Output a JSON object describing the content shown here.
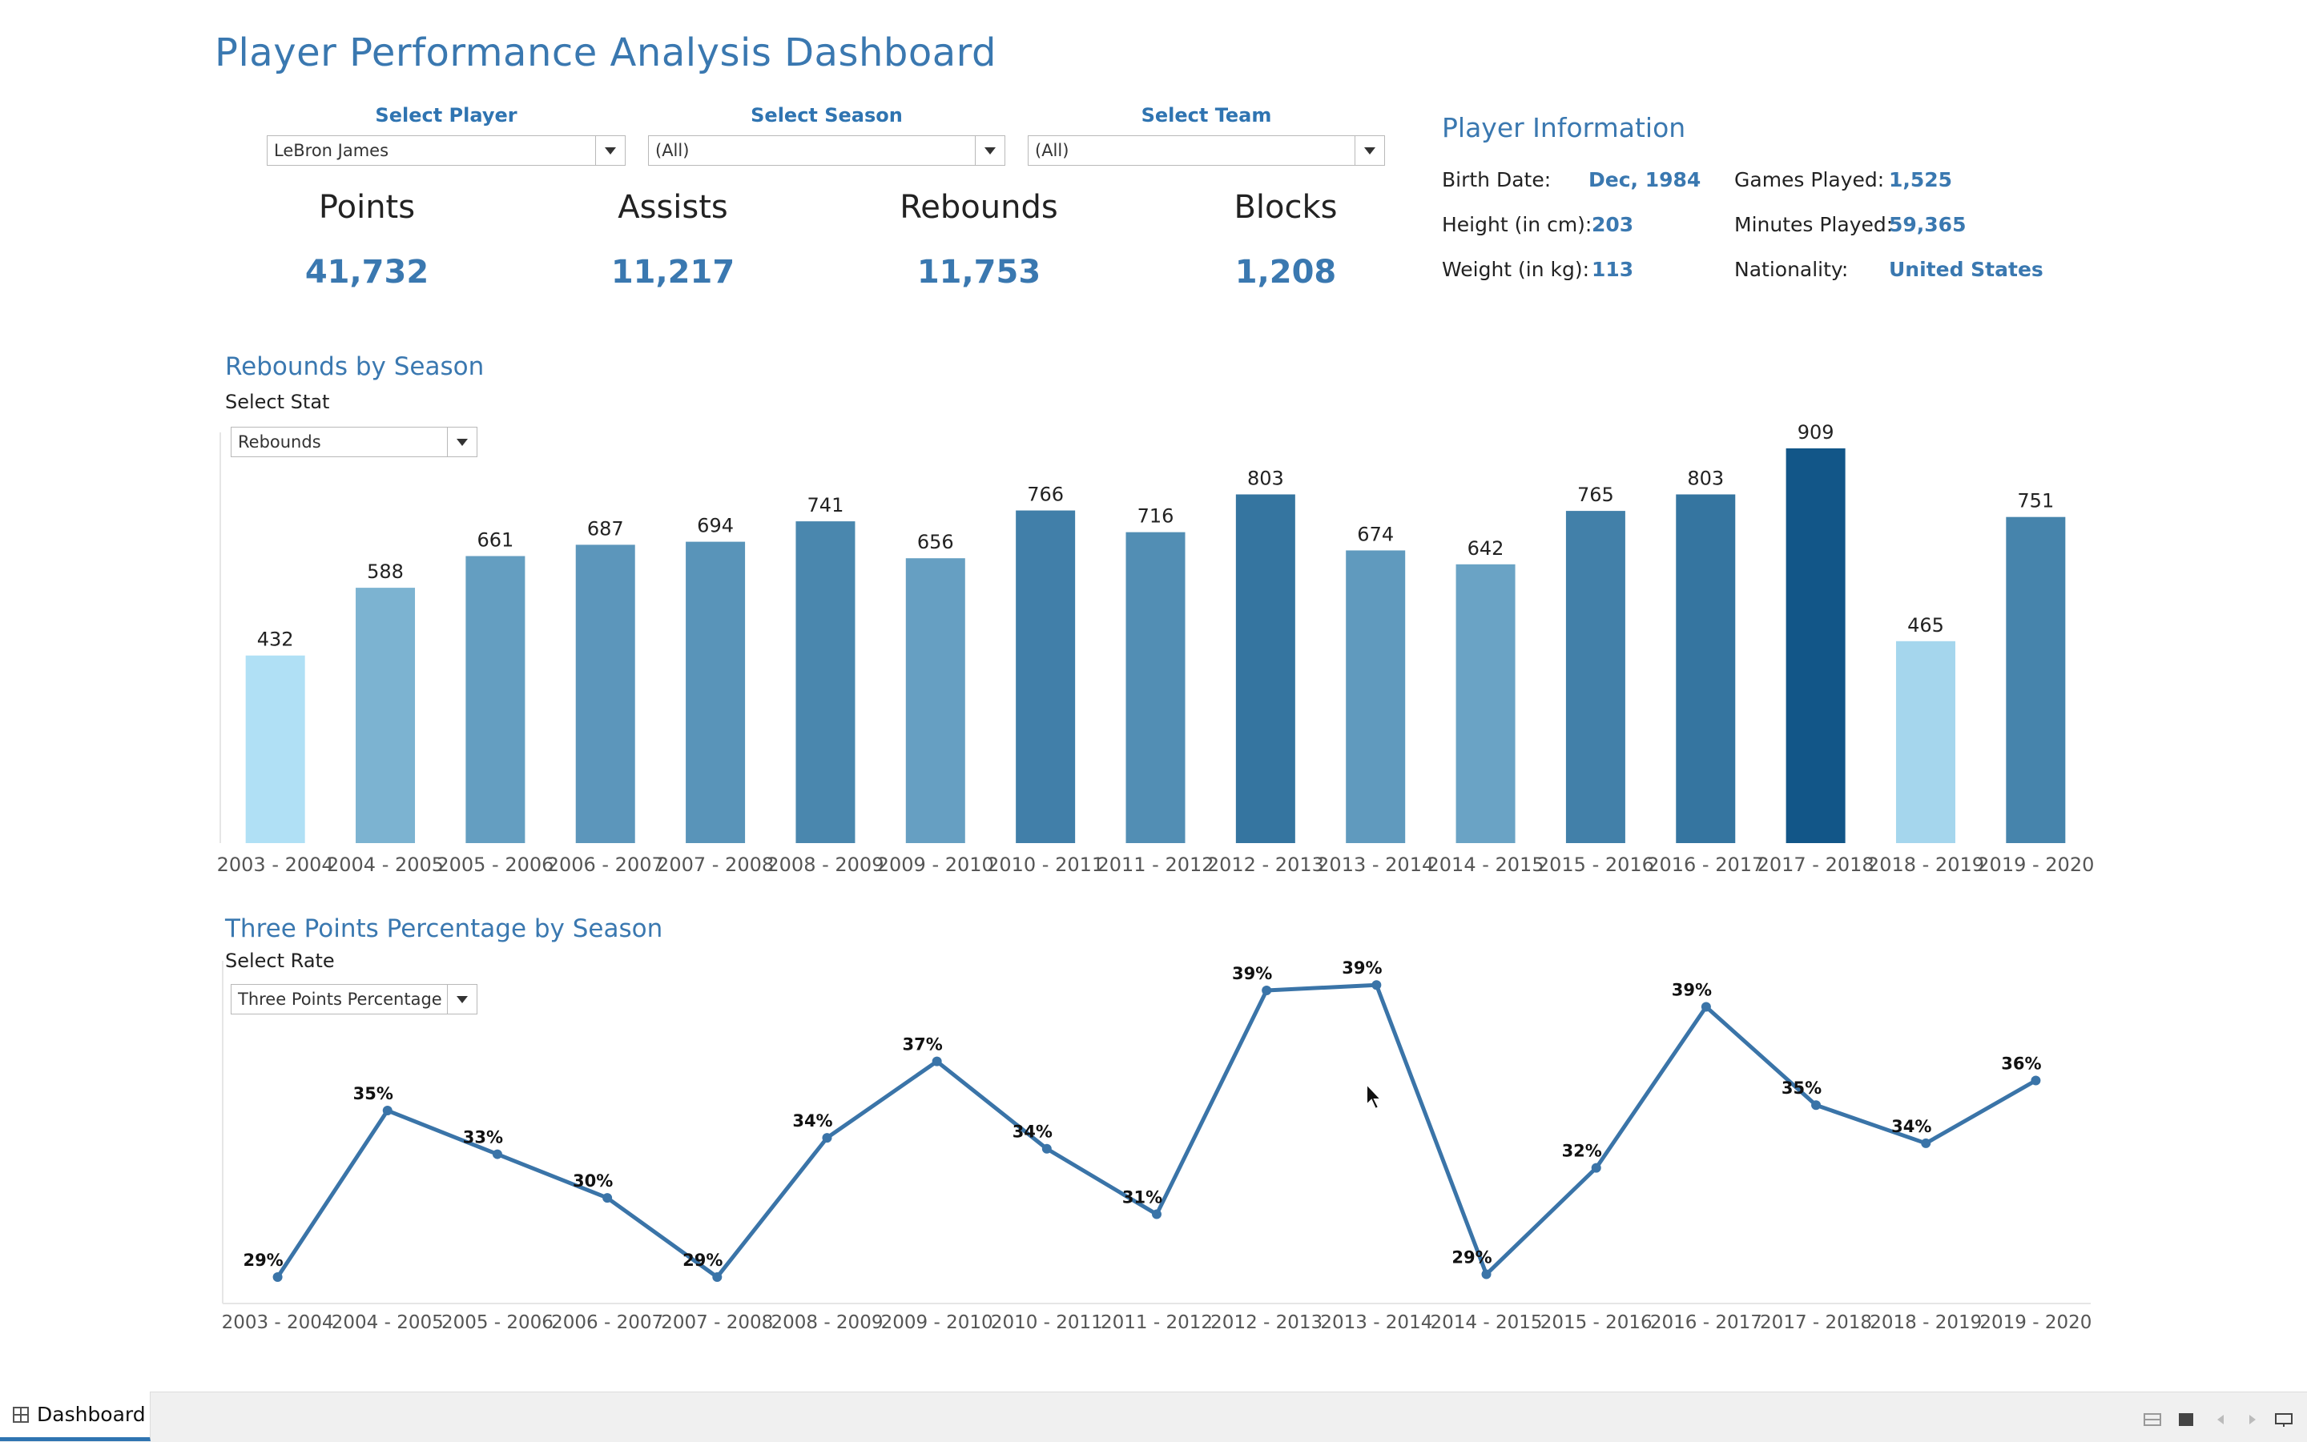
{
  "title": "Player Performance Analysis Dashboard",
  "filters": [
    {
      "label": "Select Player",
      "value": "LeBron James"
    },
    {
      "label": "Select Season",
      "value": "(All)"
    },
    {
      "label": "Select Team",
      "value": "(All)"
    }
  ],
  "kpis": [
    {
      "label": "Points",
      "value": "41,732"
    },
    {
      "label": "Assists",
      "value": "11,217"
    },
    {
      "label": "Rebounds",
      "value": "11,753"
    },
    {
      "label": "Blocks",
      "value": "1,208"
    }
  ],
  "player_info": {
    "title": "Player Information",
    "birth_label": "Birth Date:",
    "birth_value": "Dec, 1984",
    "height_label": "Height (in cm):",
    "height_value": "203",
    "weight_label": "Weight (in kg):",
    "weight_value": "113",
    "games_label": "Games Played:",
    "games_value": "1,525",
    "minutes_label": "Minutes Played:",
    "minutes_value": "59,365",
    "nationality_label": "Nationality:",
    "nationality_value": "United States"
  },
  "rebounds_section": {
    "title": "Rebounds by Season",
    "select_label": "Select Stat",
    "select_value": "Rebounds"
  },
  "threes_section": {
    "title": "Three Points Percentage by Season",
    "select_label": "Select Rate",
    "select_value": "Three Points Percentage"
  },
  "footer": {
    "tab_label": "Dashboard"
  },
  "colors": {
    "accent": "#3a78b0",
    "bar_light": "#b0e0f5",
    "bar_dark": "#125688",
    "line": "#3a74a8"
  },
  "chart_data": [
    {
      "type": "bar",
      "title": "Rebounds by Season",
      "categories": [
        "2003 - 2004",
        "2004 - 2005",
        "2005 - 2006",
        "2006 - 2007",
        "2007 - 2008",
        "2008 - 2009",
        "2009 - 2010",
        "2010 - 2011",
        "2011 - 2012",
        "2012 - 2013",
        "2013 - 2014",
        "2014 - 2015",
        "2015 - 2016",
        "2016 - 2017",
        "2017 - 2018",
        "2018 - 2019",
        "2019 - 2020"
      ],
      "values": [
        432,
        588,
        661,
        687,
        694,
        741,
        656,
        766,
        716,
        803,
        674,
        642,
        765,
        803,
        909,
        465,
        751
      ],
      "labels": [
        "432",
        "588",
        "661",
        "687",
        "694",
        "741",
        "656",
        "766",
        "716",
        "803",
        "674",
        "642",
        "765",
        "803",
        "909",
        "465",
        "751"
      ],
      "ylim": [
        0,
        909
      ],
      "grid": false,
      "color_encoding": "sequential blue by value"
    },
    {
      "type": "line",
      "title": "Three Points Percentage by Season",
      "categories": [
        "2003 - 2004",
        "2004 - 2005",
        "2005 - 2006",
        "2006 - 2007",
        "2007 - 2008",
        "2008 - 2009",
        "2009 - 2010",
        "2010 - 2011",
        "2011 - 2012",
        "2012 - 2013",
        "2013 - 2014",
        "2014 - 2015",
        "2015 - 2016",
        "2016 - 2017",
        "2017 - 2018",
        "2018 - 2019",
        "2019 - 2020"
      ],
      "values": [
        29.0,
        35.1,
        33.5,
        31.9,
        29.0,
        34.1,
        36.9,
        33.7,
        31.3,
        39.5,
        39.7,
        29.1,
        33.0,
        38.9,
        35.3,
        33.9,
        36.2
      ],
      "labels": [
        "29%",
        "35%",
        "33%",
        "30%",
        "29%",
        "34%",
        "37%",
        "34%",
        "31%",
        "39%",
        "39%",
        "29%",
        "32%",
        "39%",
        "35%",
        "34%",
        "36%"
      ],
      "ylim": [
        28.5,
        40
      ],
      "grid": false
    }
  ]
}
